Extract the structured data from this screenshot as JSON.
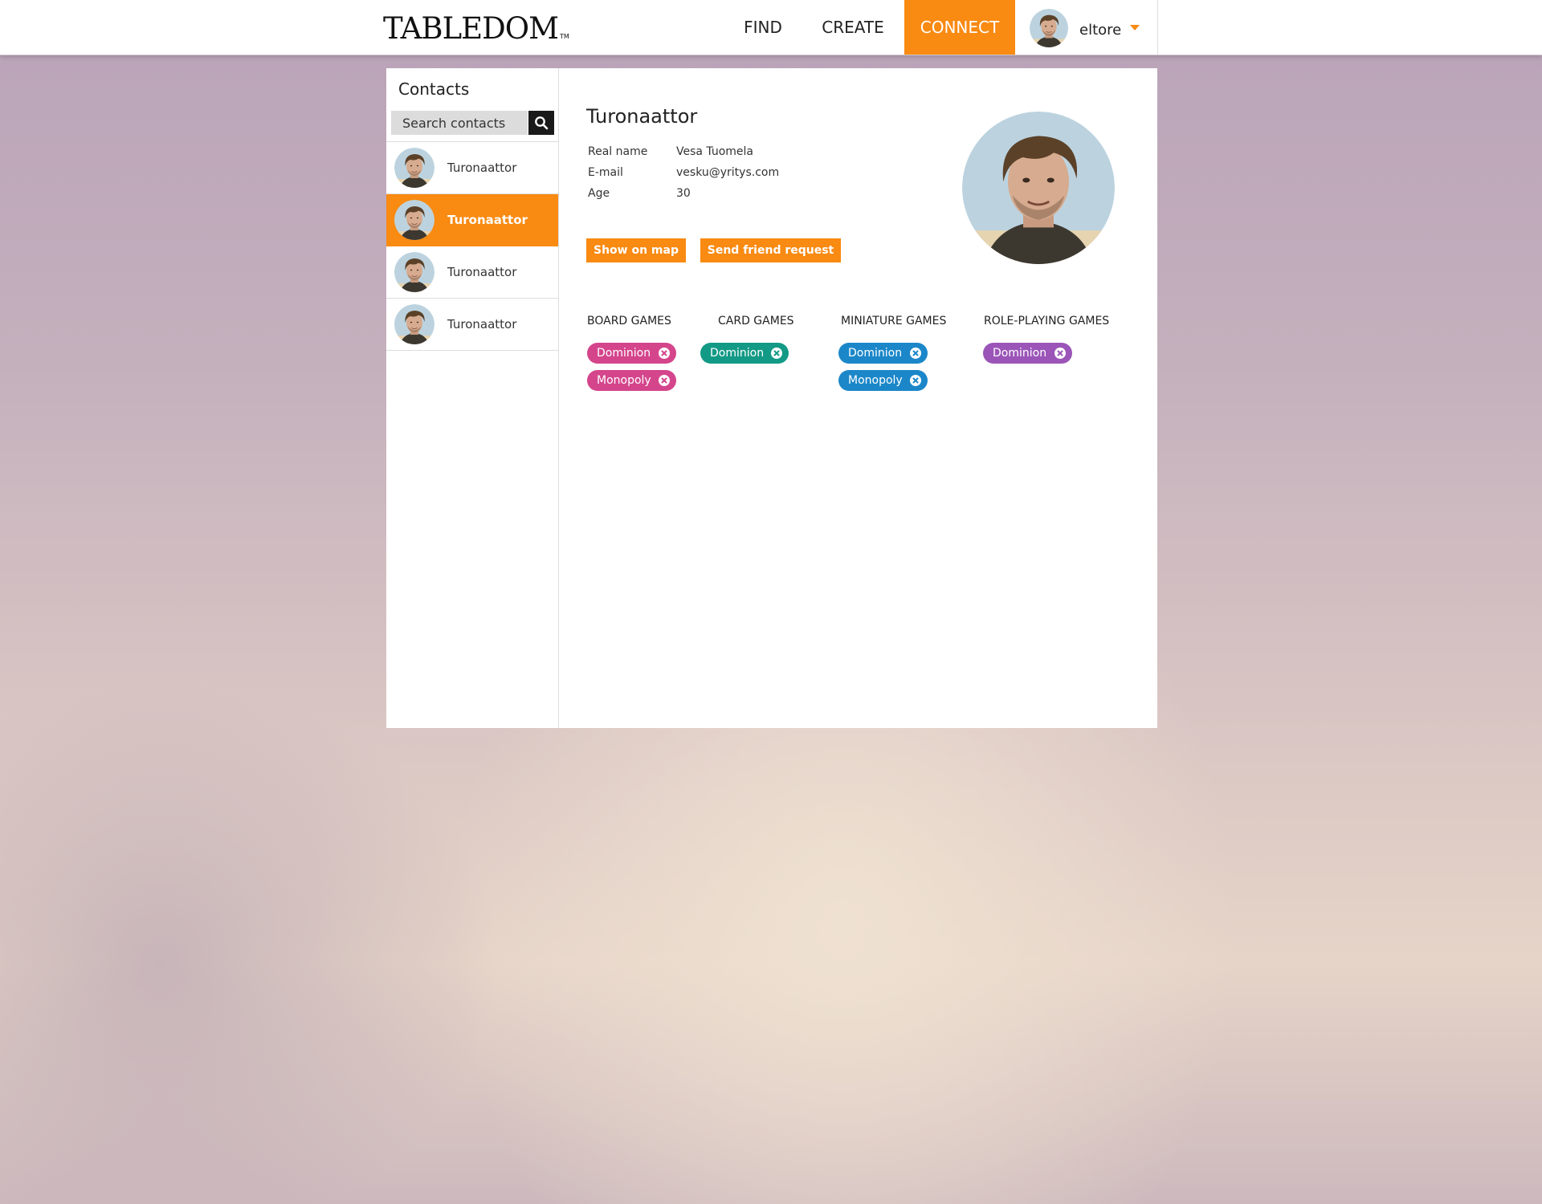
{
  "header": {
    "logo": "TABLEDOM",
    "logo_tm": "TM",
    "nav": [
      {
        "label": "FIND"
      },
      {
        "label": "CREATE"
      },
      {
        "label": "CONNECT",
        "active": true
      }
    ],
    "user": {
      "name": "eltore",
      "avatar_icon": "user-avatar",
      "caret_icon": "caret-down-icon"
    },
    "accent_color": "#f98a12"
  },
  "sidebar": {
    "title": "Contacts",
    "search": {
      "placeholder": "Search contacts",
      "icon": "search-icon"
    },
    "contacts": [
      {
        "name": "Turonaattor",
        "active": false
      },
      {
        "name": "Turonaattor",
        "active": true
      },
      {
        "name": "Turonaattor",
        "active": false
      },
      {
        "name": "Turonaattor",
        "active": false
      }
    ]
  },
  "profile": {
    "name": "Turonaattor",
    "fields": [
      {
        "label": "Real name",
        "value": "Vesa Tuomela"
      },
      {
        "label": "E-mail",
        "value": "vesku@yritys.com"
      },
      {
        "label": "Age",
        "value": "30"
      }
    ],
    "buttons": {
      "map": "Show on map",
      "friend": "Send friend request"
    },
    "categories": [
      {
        "title": "BOARD GAMES",
        "color": "#d4458c",
        "tags": [
          "Dominion",
          "Monopoly"
        ]
      },
      {
        "title": "CARD GAMES",
        "color": "#139a86",
        "tags": [
          "Dominion"
        ]
      },
      {
        "title": "MINIATURE GAMES",
        "color": "#1b87c9",
        "tags": [
          "Dominion",
          "Monopoly"
        ]
      },
      {
        "title": "ROLE-PLAYING GAMES",
        "color": "#9b55b8",
        "tags": [
          "Dominion"
        ]
      }
    ]
  }
}
